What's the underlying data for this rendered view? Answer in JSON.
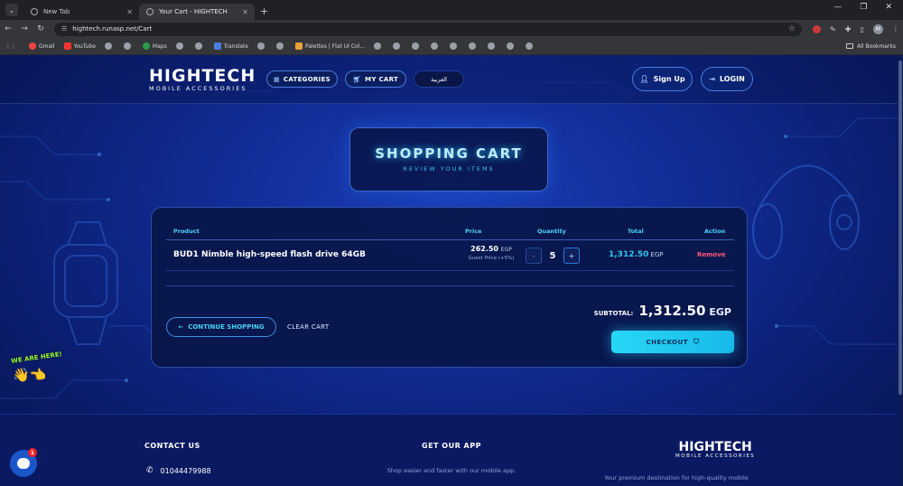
{
  "browser": {
    "tabs": [
      {
        "title": "New Tab",
        "active": false
      },
      {
        "title": "Your Cart - HIGHTECH",
        "active": true
      }
    ],
    "url": "hightech.runasp.net/Cart",
    "bookmarks": [
      "Gmail",
      "YouTube",
      "Maps",
      "Translate",
      "Palettes | Flat UI Col..."
    ],
    "all_bookmarks": "All Bookmarks",
    "avatar_letter": "M"
  },
  "header": {
    "logo_main": "HIGHTECH",
    "logo_sub": "MOBILE ACCESSORIES",
    "nav": {
      "categories": "CATEGORIES",
      "cart": "MY CART",
      "language": "العربية"
    },
    "signup": "Sign Up",
    "login": "LOGIN"
  },
  "title_card": {
    "title": "SHOPPING CART",
    "subtitle": "REVIEW YOUR ITEMS"
  },
  "cart": {
    "columns": [
      "Product",
      "Price",
      "Quantity",
      "Total",
      "Action"
    ],
    "items": [
      {
        "product": "BUD1 Nimble high-speed flash drive 64GB",
        "price": "262.50",
        "price_currency": "EGP",
        "price_note": "Guest Price (+5%)",
        "quantity": "5",
        "total": "1,312.50",
        "total_currency": "EGP",
        "action": "Remove"
      }
    ],
    "continue_label": "CONTINUE SHOPPING",
    "clear_label": "CLEAR CART",
    "subtotal_label": "SUBTOTAL:",
    "subtotal_value": "1,312.50",
    "subtotal_currency": "EGP",
    "checkout_label": "CHECKOUT"
  },
  "footer": {
    "contact_title": "CONTACT US",
    "phone": "01044479988",
    "app_title": "GET OUR APP",
    "app_desc": "Shop easier and faster with our mobile app.",
    "logo_main": "HIGHTECH",
    "logo_sub": "MOBILE ACCESSORIES",
    "desc": "Your premium destination for high-quality mobile"
  },
  "chat": {
    "tagline": "WE ARE HERE!",
    "badge": "1"
  },
  "colors": {
    "accent": "#27d7f5",
    "remove": "#ff5a7a",
    "background": "#102b92"
  }
}
